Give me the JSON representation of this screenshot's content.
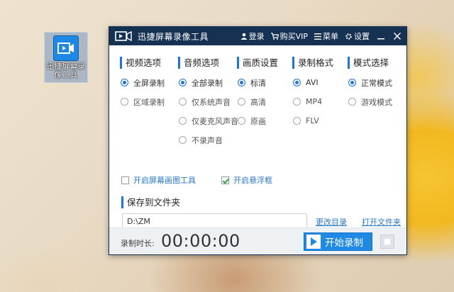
{
  "desktop_icon": {
    "label": "迅捷屏幕录像工具"
  },
  "window": {
    "title": "迅捷屏幕录像工具",
    "toolbar": {
      "login": "登录",
      "vip": "购买VIP",
      "menu": "菜单",
      "settings": "设置"
    }
  },
  "sections": [
    {
      "title": "视频选项",
      "options": [
        {
          "label": "全屏录制",
          "selected": true
        },
        {
          "label": "区域录制",
          "selected": false
        }
      ]
    },
    {
      "title": "音频选项",
      "options": [
        {
          "label": "全部录制",
          "selected": true
        },
        {
          "label": "仅系统声音",
          "selected": false
        },
        {
          "label": "仅麦克风声音",
          "selected": false
        },
        {
          "label": "不录声音",
          "selected": false
        }
      ]
    },
    {
      "title": "画质设置",
      "options": [
        {
          "label": "标清",
          "selected": true
        },
        {
          "label": "高清",
          "selected": false
        },
        {
          "label": "原画",
          "selected": false
        }
      ]
    },
    {
      "title": "录制格式",
      "options": [
        {
          "label": "AVI",
          "selected": true
        },
        {
          "label": "MP4",
          "selected": false
        },
        {
          "label": "FLV",
          "selected": false
        }
      ]
    },
    {
      "title": "模式选择",
      "options": [
        {
          "label": "正常模式",
          "selected": true
        },
        {
          "label": "游戏模式",
          "selected": false
        }
      ]
    }
  ],
  "checkboxes": [
    {
      "label": "开启屏幕画图工具",
      "checked": false
    },
    {
      "label": "开启悬浮框",
      "checked": true
    }
  ],
  "save": {
    "title": "保存到文件夹",
    "path": "D:\\ZM",
    "change_dir": "更改目录",
    "open_folder": "打开文件夹"
  },
  "footer": {
    "duration_label": "录制时长:",
    "duration": "00:00:00",
    "start_label": "开始录制"
  },
  "colors": {
    "titlebar": "#153253",
    "accent": "#1a73e8",
    "button": "#1f8ae6",
    "link": "#2a78c8"
  }
}
